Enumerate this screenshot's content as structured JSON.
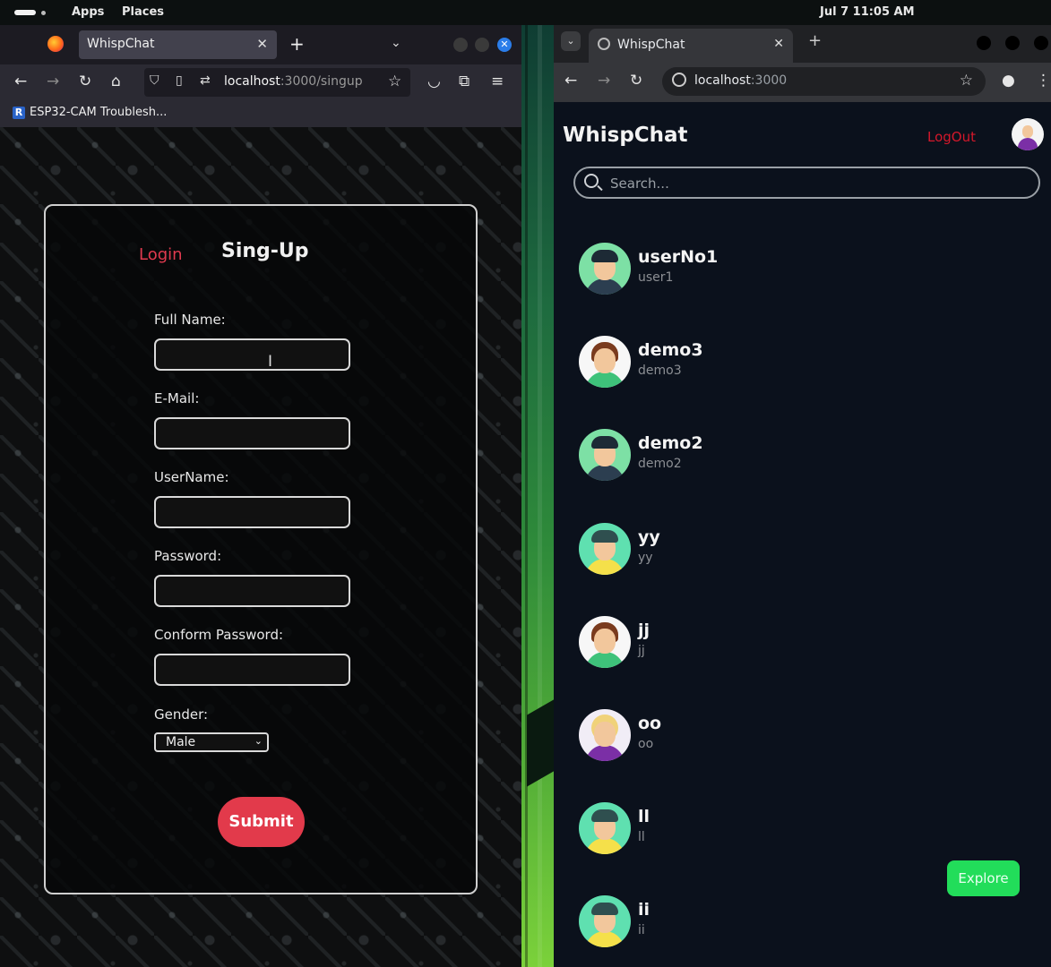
{
  "system_bar": {
    "apps": "Apps",
    "places": "Places",
    "clock": "Jul 7  11:05 AM"
  },
  "firefox": {
    "tab_title": "WhispChat",
    "url_host": "localhost",
    "url_path": ":3000/singup",
    "bookmark": "ESP32-CAM Troublesh..."
  },
  "signup": {
    "login_tab": "Login",
    "signup_tab": "Sing-Up",
    "fields": [
      {
        "label": "Full Name:",
        "value": ""
      },
      {
        "label": "E-Mail:",
        "value": ""
      },
      {
        "label": "UserName:",
        "value": ""
      },
      {
        "label": "Password:",
        "value": ""
      },
      {
        "label": "Conform Password:",
        "value": ""
      }
    ],
    "gender_label": "Gender:",
    "gender_value": "Male",
    "submit": "Submit",
    "accent_color": "#e23a4b"
  },
  "chrome": {
    "tab_title": "WhispChat",
    "url_host": "localhost",
    "url_port": ":3000"
  },
  "chat": {
    "brand": "WhispChat",
    "logout": "LogOut",
    "search_placeholder": "Search...",
    "users": [
      {
        "name": "userNo1",
        "username": "user1",
        "avatar": "male-avatar-icon"
      },
      {
        "name": "demo3",
        "username": "demo3",
        "avatar": "female-avatar-icon"
      },
      {
        "name": "demo2",
        "username": "demo2",
        "avatar": "male-avatar-icon"
      },
      {
        "name": "yy",
        "username": "yy",
        "avatar": "boy-avatar-icon"
      },
      {
        "name": "jj",
        "username": "jj",
        "avatar": "female-avatar-icon"
      },
      {
        "name": "oo",
        "username": "oo",
        "avatar": "girl-avatar-icon"
      },
      {
        "name": "ll",
        "username": "ll",
        "avatar": "boy-avatar-icon"
      },
      {
        "name": "ii",
        "username": "ii",
        "avatar": "boy-avatar-icon"
      }
    ],
    "explore": "Explore",
    "explore_color": "#22dd5a",
    "logout_color": "#d4182b"
  }
}
